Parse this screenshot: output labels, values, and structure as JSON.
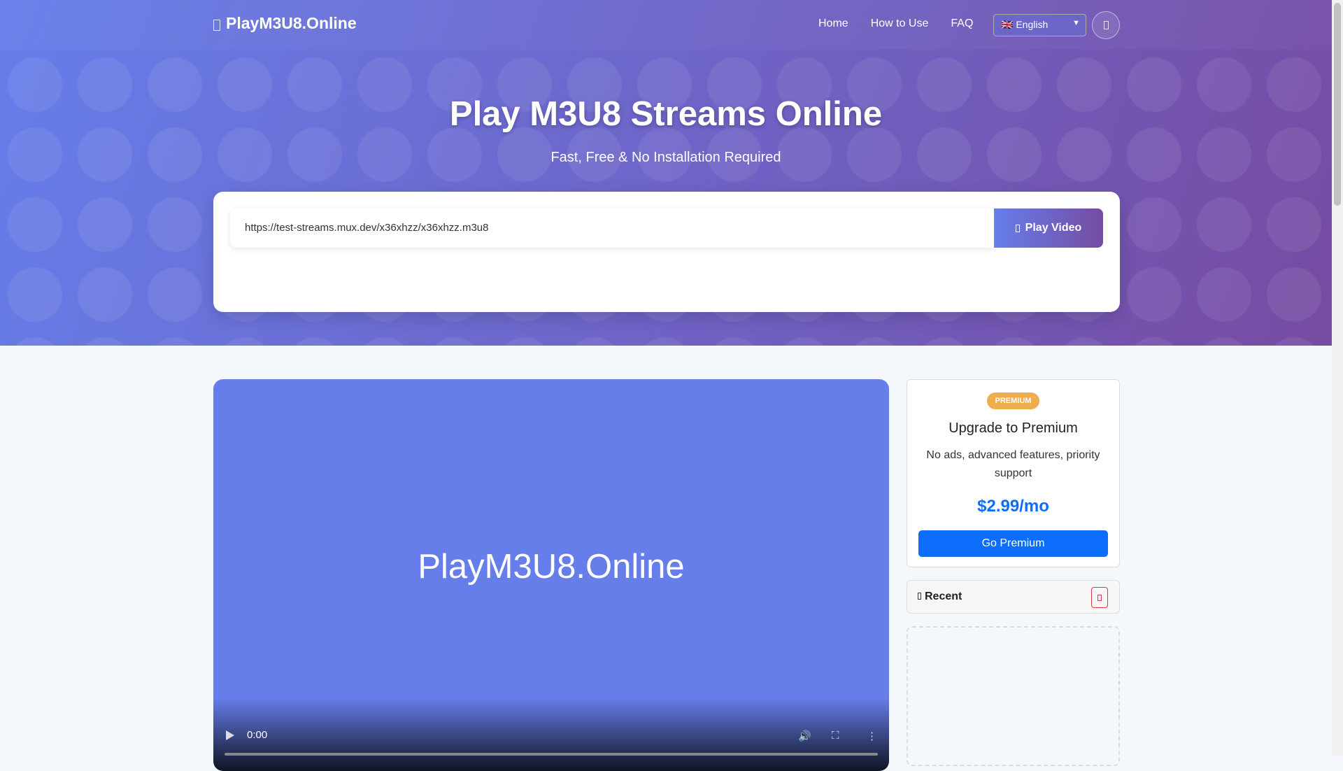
{
  "nav": {
    "brand": "PlayM3U8.Online",
    "links": [
      "Home",
      "How to Use",
      "FAQ"
    ],
    "language": "🇬🇧 English"
  },
  "hero": {
    "title": "Play M3U8 Streams Online",
    "subtitle": "Fast, Free & No Installation Required",
    "url_value": "https://test-streams.mux.dev/x36xhzz/x36xhzz.m3u8",
    "play_label": "Play Video"
  },
  "player": {
    "watermark": "PlayM3U8.Online",
    "time": "0:00",
    "progress": 0
  },
  "premium": {
    "badge": "PREMIUM",
    "title": "Upgrade to Premium",
    "desc": "No ads, advanced features, priority support",
    "price": "$2.99/mo",
    "button": "Go Premium"
  },
  "recent": {
    "label": "Recent"
  }
}
